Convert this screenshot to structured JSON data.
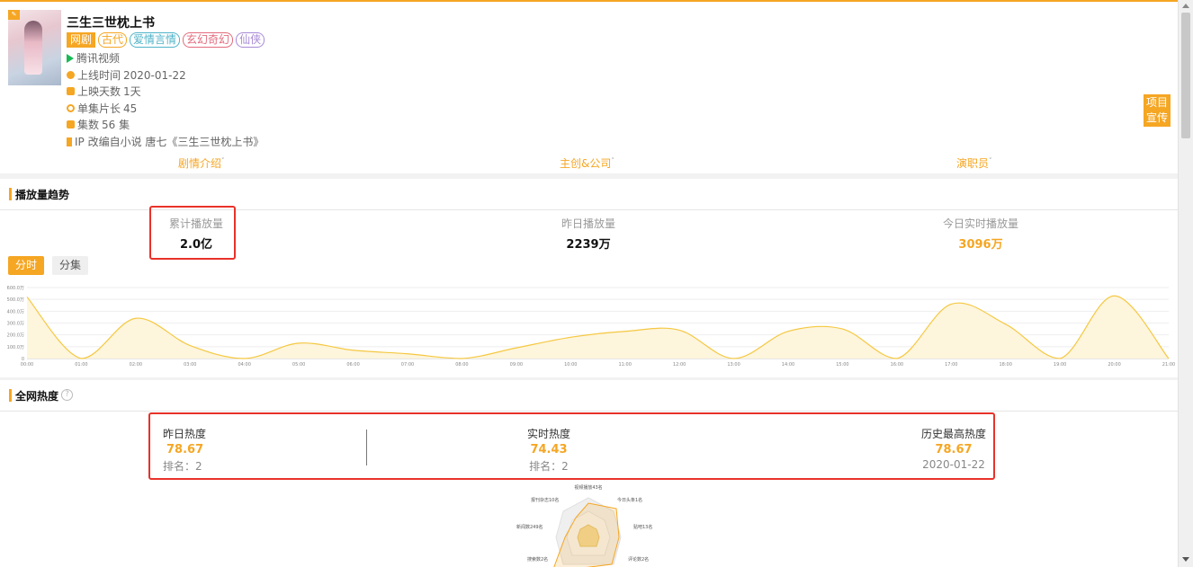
{
  "drama": {
    "title": "三生三世枕上书",
    "tags": [
      "网剧",
      "古代",
      "爱情言情",
      "玄幻奇幻",
      "仙侠"
    ],
    "platform": "腾讯视频",
    "launch_label": "上线时间",
    "launch_value": "2020-01-22",
    "days_label": "上映天数",
    "days_value": "1天",
    "episode_len_label": "单集片长",
    "episode_len_value": "45",
    "episodes_label": "集数",
    "episodes_value": "56 集",
    "ip_text": "IP 改编自小说 唐七《三生三世枕上书》",
    "promo_label_line1": "项目",
    "promo_label_line2": "宣传"
  },
  "nav": {
    "plot": "剧情介绍",
    "crew": "主创&公司",
    "cast": "演职员"
  },
  "play_trend": {
    "section_title": "播放量趋势",
    "cumulative_label": "累计播放量",
    "cumulative_value": "2.0亿",
    "yesterday_label": "昨日播放量",
    "yesterday_value": "2239万",
    "today_label": "今日实时播放量",
    "today_value": "3096万",
    "btn_timeshare": "分时",
    "btn_episode": "分集"
  },
  "chart_data": {
    "type": "area",
    "y_ticks": [
      "0",
      "100.0万",
      "200.0万",
      "300.0万",
      "400.0万",
      "500.0万",
      "600.0万"
    ],
    "ylim": [
      0,
      6000000
    ],
    "x": [
      "00:00",
      "01:00",
      "02:00",
      "03:00",
      "04:00",
      "05:00",
      "06:00",
      "07:00",
      "08:00",
      "09:00",
      "10:00",
      "11:00",
      "12:00",
      "13:00",
      "14:00",
      "15:00",
      "16:00",
      "17:00",
      "18:00",
      "19:00",
      "20:00",
      "21:00"
    ],
    "series": [
      {
        "values": [
          5200000,
          0,
          3400000,
          1100000,
          0,
          1300000,
          700000,
          400000,
          0,
          900000,
          1800000,
          2300000,
          2400000,
          0,
          2300000,
          2500000,
          0,
          4600000,
          2900000,
          0,
          5300000,
          0
        ]
      }
    ],
    "colors": {
      "line": "#f5c842",
      "fill": "#fdf5dc"
    }
  },
  "heat": {
    "section_title": "全网热度",
    "help": "?",
    "yesterday_label": "昨日热度",
    "yesterday_value": "78.67",
    "yesterday_rank": "排名：2",
    "realtime_label": "实时热度",
    "realtime_value": "74.43",
    "realtime_rank": "排名：2",
    "history_label": "历史最高热度",
    "history_value": "78.67",
    "history_date": "2020-01-22",
    "radar_labels": [
      "视频播放43名",
      "今日头条1名",
      "贴吧13名",
      "评论数2名",
      "搜索数2名",
      "新闻数249名",
      "报刊杂志10名"
    ]
  },
  "colors": {
    "accent": "#f5a623",
    "highlight_box": "#e8322a"
  }
}
